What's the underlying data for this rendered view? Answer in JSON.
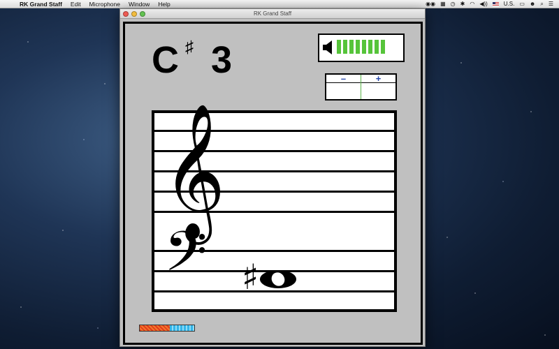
{
  "menubar": {
    "app_name": "RK Grand Staff",
    "items": [
      "Edit",
      "Microphone",
      "Window",
      "Help"
    ],
    "input_source": "U.S."
  },
  "window": {
    "title": "RK Grand Staff"
  },
  "note": {
    "letter": "C",
    "accidental": "♯",
    "octave": "3"
  },
  "volume": {
    "icon": "speaker-icon",
    "bars_lit": 8,
    "color": "#56c43a"
  },
  "stepper": {
    "minus_label": "–",
    "plus_label": "+"
  },
  "staff": {
    "treble_clef": "𝄞",
    "bass_clef": "𝄢",
    "note_accidental": "♯"
  },
  "colors": {
    "accent_green": "#56c43a",
    "stepper_text": "#2244aa"
  }
}
